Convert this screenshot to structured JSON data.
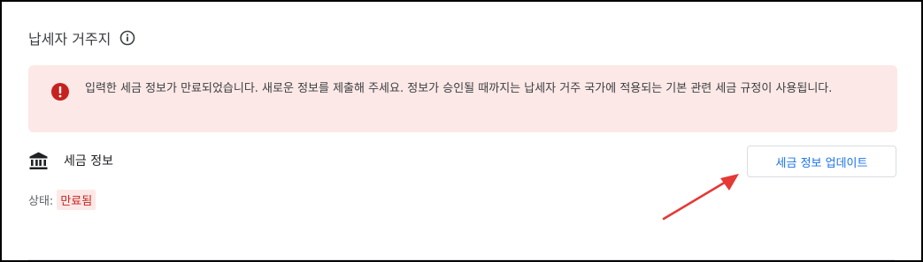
{
  "section": {
    "title": "납세자 거주지"
  },
  "alert": {
    "message": "입력한 세금 정보가 만료되었습니다. 새로운 정보를 제출해 주세요. 정보가 승인될 때까지는 납세자 거주 국가에 적용되는 기본 관련 세금 규정이 사용됩니다.",
    "color": "#fce8e6",
    "icon_color": "#c5221f"
  },
  "tax_info": {
    "label": "세금 정보",
    "update_button": "세금 정보 업데이트"
  },
  "status": {
    "label": "상태:",
    "value": "만료됨"
  },
  "colors": {
    "accent": "#1a73e8",
    "error": "#c5221f",
    "arrow": "#e53935"
  },
  "icons": {
    "info": "info-icon",
    "alert": "error-icon",
    "bank": "bank-icon"
  }
}
